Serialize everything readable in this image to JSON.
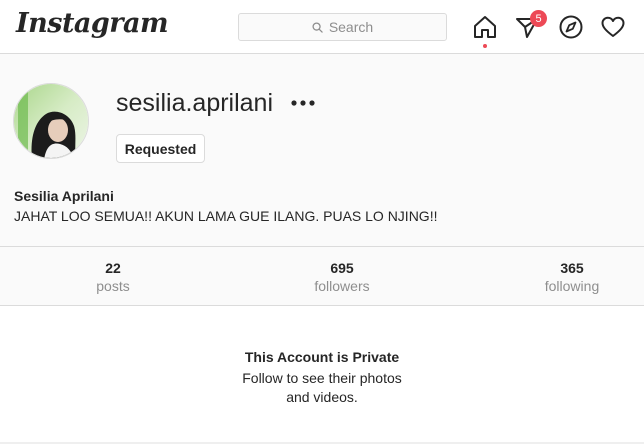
{
  "header": {
    "logo": "Instagram",
    "search_placeholder": "Search",
    "notification_count": "5",
    "icons": [
      "home-icon",
      "direct-message-icon",
      "explore-compass-icon",
      "activity-heart-icon"
    ]
  },
  "profile": {
    "username": "sesilia.aprilani",
    "follow_button": "Requested",
    "full_name": "Sesilia Aprilani",
    "bio": "JAHAT LOO SEMUA!! AKUN LAMA GUE ILANG. PUAS LO NJING!!"
  },
  "stats": [
    {
      "value": "22",
      "label": "posts"
    },
    {
      "value": "695",
      "label": "followers"
    },
    {
      "value": "365",
      "label": "following"
    }
  ],
  "private_notice": {
    "title": "This Account is Private",
    "subtitle": "Follow to see their photos and videos."
  },
  "colors": {
    "badge": "#ed4956",
    "border": "#dbdbdb",
    "muted_text": "#8e8e8e"
  }
}
